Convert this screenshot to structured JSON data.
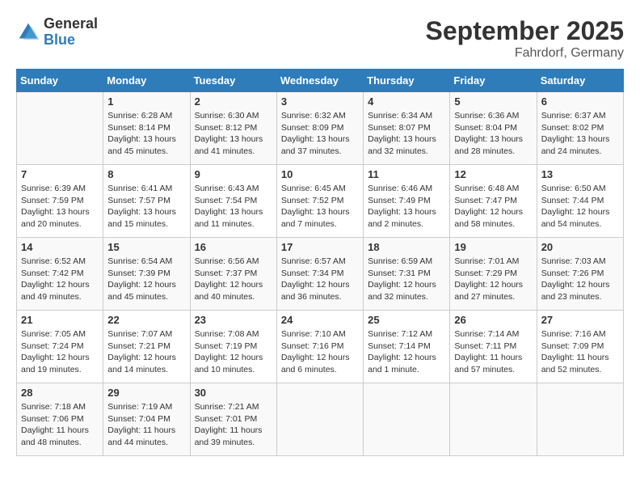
{
  "header": {
    "logo_general": "General",
    "logo_blue": "Blue",
    "month_year": "September 2025",
    "location": "Fahrdorf, Germany"
  },
  "weekdays": [
    "Sunday",
    "Monday",
    "Tuesday",
    "Wednesday",
    "Thursday",
    "Friday",
    "Saturday"
  ],
  "weeks": [
    [
      {
        "day": "",
        "sunrise": "",
        "sunset": "",
        "daylight": ""
      },
      {
        "day": "1",
        "sunrise": "Sunrise: 6:28 AM",
        "sunset": "Sunset: 8:14 PM",
        "daylight": "Daylight: 13 hours and 45 minutes."
      },
      {
        "day": "2",
        "sunrise": "Sunrise: 6:30 AM",
        "sunset": "Sunset: 8:12 PM",
        "daylight": "Daylight: 13 hours and 41 minutes."
      },
      {
        "day": "3",
        "sunrise": "Sunrise: 6:32 AM",
        "sunset": "Sunset: 8:09 PM",
        "daylight": "Daylight: 13 hours and 37 minutes."
      },
      {
        "day": "4",
        "sunrise": "Sunrise: 6:34 AM",
        "sunset": "Sunset: 8:07 PM",
        "daylight": "Daylight: 13 hours and 32 minutes."
      },
      {
        "day": "5",
        "sunrise": "Sunrise: 6:36 AM",
        "sunset": "Sunset: 8:04 PM",
        "daylight": "Daylight: 13 hours and 28 minutes."
      },
      {
        "day": "6",
        "sunrise": "Sunrise: 6:37 AM",
        "sunset": "Sunset: 8:02 PM",
        "daylight": "Daylight: 13 hours and 24 minutes."
      }
    ],
    [
      {
        "day": "7",
        "sunrise": "Sunrise: 6:39 AM",
        "sunset": "Sunset: 7:59 PM",
        "daylight": "Daylight: 13 hours and 20 minutes."
      },
      {
        "day": "8",
        "sunrise": "Sunrise: 6:41 AM",
        "sunset": "Sunset: 7:57 PM",
        "daylight": "Daylight: 13 hours and 15 minutes."
      },
      {
        "day": "9",
        "sunrise": "Sunrise: 6:43 AM",
        "sunset": "Sunset: 7:54 PM",
        "daylight": "Daylight: 13 hours and 11 minutes."
      },
      {
        "day": "10",
        "sunrise": "Sunrise: 6:45 AM",
        "sunset": "Sunset: 7:52 PM",
        "daylight": "Daylight: 13 hours and 7 minutes."
      },
      {
        "day": "11",
        "sunrise": "Sunrise: 6:46 AM",
        "sunset": "Sunset: 7:49 PM",
        "daylight": "Daylight: 13 hours and 2 minutes."
      },
      {
        "day": "12",
        "sunrise": "Sunrise: 6:48 AM",
        "sunset": "Sunset: 7:47 PM",
        "daylight": "Daylight: 12 hours and 58 minutes."
      },
      {
        "day": "13",
        "sunrise": "Sunrise: 6:50 AM",
        "sunset": "Sunset: 7:44 PM",
        "daylight": "Daylight: 12 hours and 54 minutes."
      }
    ],
    [
      {
        "day": "14",
        "sunrise": "Sunrise: 6:52 AM",
        "sunset": "Sunset: 7:42 PM",
        "daylight": "Daylight: 12 hours and 49 minutes."
      },
      {
        "day": "15",
        "sunrise": "Sunrise: 6:54 AM",
        "sunset": "Sunset: 7:39 PM",
        "daylight": "Daylight: 12 hours and 45 minutes."
      },
      {
        "day": "16",
        "sunrise": "Sunrise: 6:56 AM",
        "sunset": "Sunset: 7:37 PM",
        "daylight": "Daylight: 12 hours and 40 minutes."
      },
      {
        "day": "17",
        "sunrise": "Sunrise: 6:57 AM",
        "sunset": "Sunset: 7:34 PM",
        "daylight": "Daylight: 12 hours and 36 minutes."
      },
      {
        "day": "18",
        "sunrise": "Sunrise: 6:59 AM",
        "sunset": "Sunset: 7:31 PM",
        "daylight": "Daylight: 12 hours and 32 minutes."
      },
      {
        "day": "19",
        "sunrise": "Sunrise: 7:01 AM",
        "sunset": "Sunset: 7:29 PM",
        "daylight": "Daylight: 12 hours and 27 minutes."
      },
      {
        "day": "20",
        "sunrise": "Sunrise: 7:03 AM",
        "sunset": "Sunset: 7:26 PM",
        "daylight": "Daylight: 12 hours and 23 minutes."
      }
    ],
    [
      {
        "day": "21",
        "sunrise": "Sunrise: 7:05 AM",
        "sunset": "Sunset: 7:24 PM",
        "daylight": "Daylight: 12 hours and 19 minutes."
      },
      {
        "day": "22",
        "sunrise": "Sunrise: 7:07 AM",
        "sunset": "Sunset: 7:21 PM",
        "daylight": "Daylight: 12 hours and 14 minutes."
      },
      {
        "day": "23",
        "sunrise": "Sunrise: 7:08 AM",
        "sunset": "Sunset: 7:19 PM",
        "daylight": "Daylight: 12 hours and 10 minutes."
      },
      {
        "day": "24",
        "sunrise": "Sunrise: 7:10 AM",
        "sunset": "Sunset: 7:16 PM",
        "daylight": "Daylight: 12 hours and 6 minutes."
      },
      {
        "day": "25",
        "sunrise": "Sunrise: 7:12 AM",
        "sunset": "Sunset: 7:14 PM",
        "daylight": "Daylight: 12 hours and 1 minute."
      },
      {
        "day": "26",
        "sunrise": "Sunrise: 7:14 AM",
        "sunset": "Sunset: 7:11 PM",
        "daylight": "Daylight: 11 hours and 57 minutes."
      },
      {
        "day": "27",
        "sunrise": "Sunrise: 7:16 AM",
        "sunset": "Sunset: 7:09 PM",
        "daylight": "Daylight: 11 hours and 52 minutes."
      }
    ],
    [
      {
        "day": "28",
        "sunrise": "Sunrise: 7:18 AM",
        "sunset": "Sunset: 7:06 PM",
        "daylight": "Daylight: 11 hours and 48 minutes."
      },
      {
        "day": "29",
        "sunrise": "Sunrise: 7:19 AM",
        "sunset": "Sunset: 7:04 PM",
        "daylight": "Daylight: 11 hours and 44 minutes."
      },
      {
        "day": "30",
        "sunrise": "Sunrise: 7:21 AM",
        "sunset": "Sunset: 7:01 PM",
        "daylight": "Daylight: 11 hours and 39 minutes."
      },
      {
        "day": "",
        "sunrise": "",
        "sunset": "",
        "daylight": ""
      },
      {
        "day": "",
        "sunrise": "",
        "sunset": "",
        "daylight": ""
      },
      {
        "day": "",
        "sunrise": "",
        "sunset": "",
        "daylight": ""
      },
      {
        "day": "",
        "sunrise": "",
        "sunset": "",
        "daylight": ""
      }
    ]
  ]
}
